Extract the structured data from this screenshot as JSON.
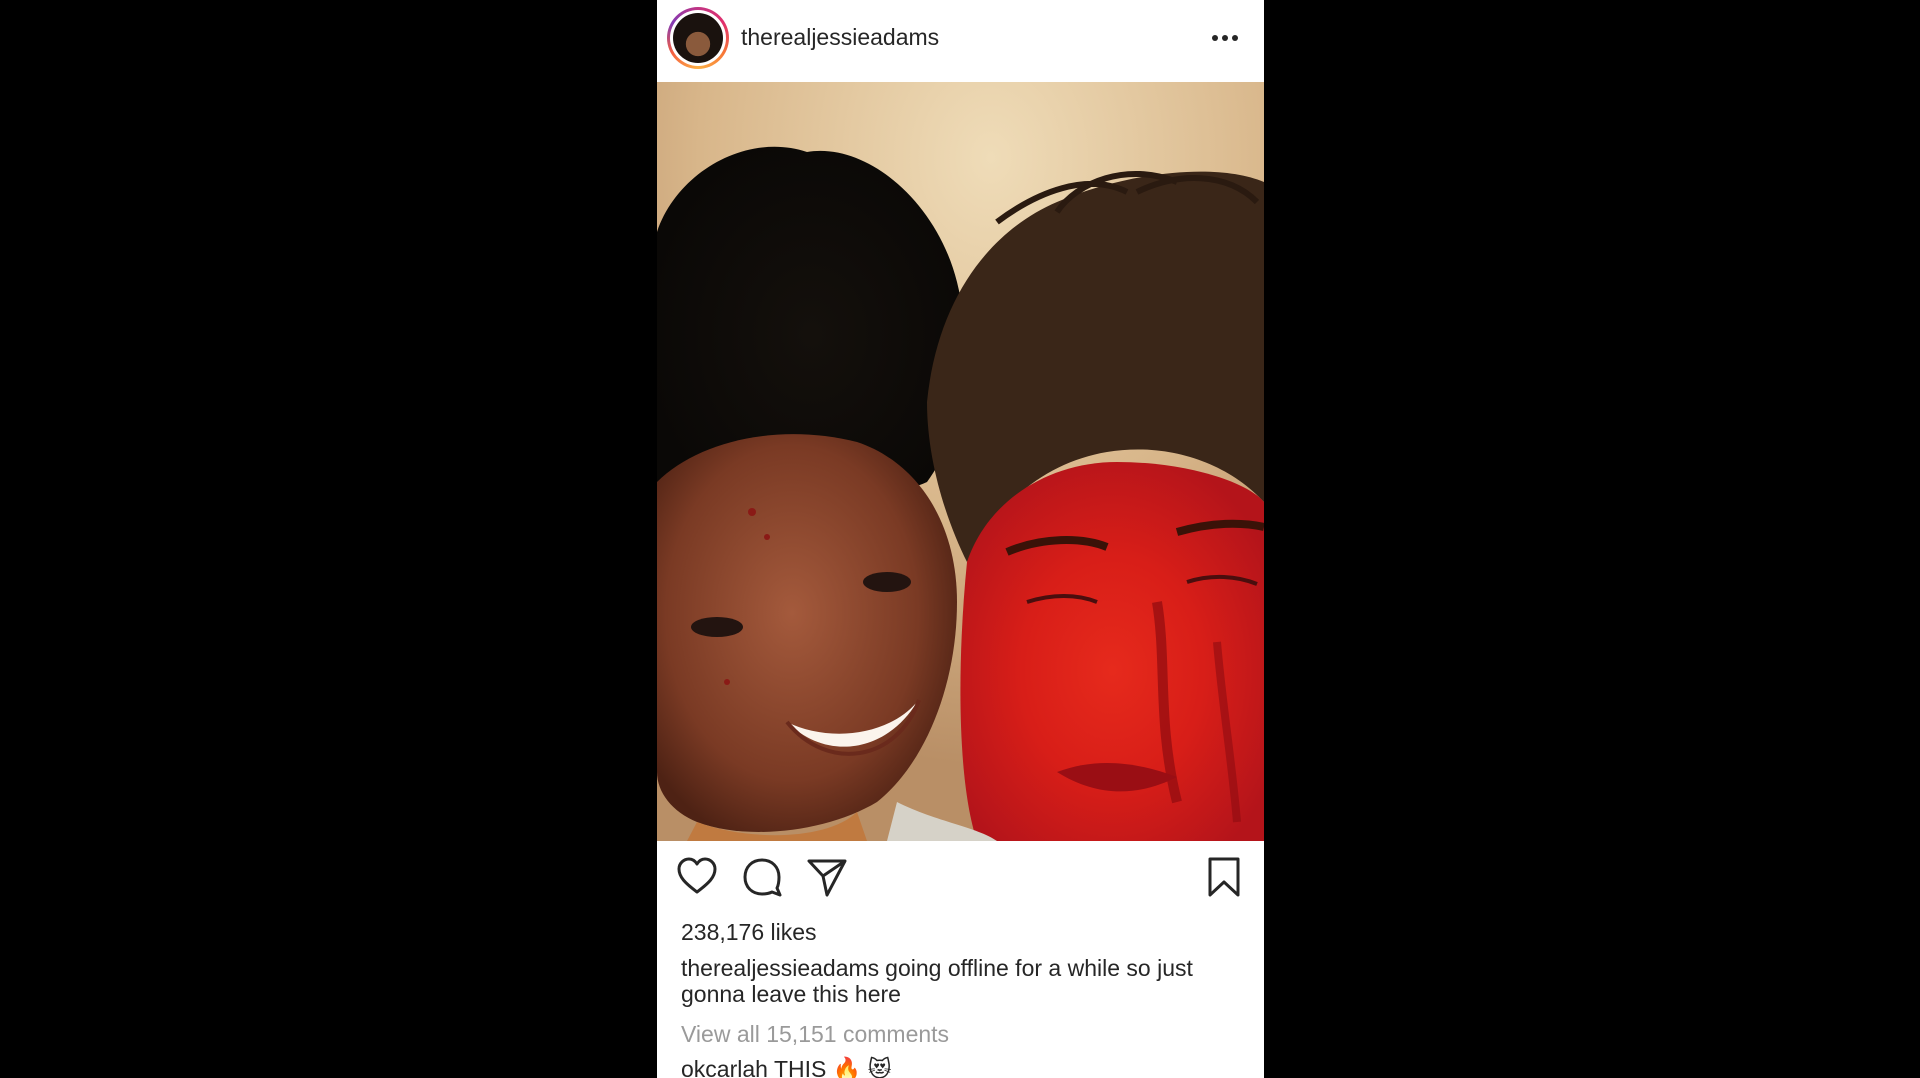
{
  "post": {
    "username": "therealjessieadams",
    "likes": "238,176 likes",
    "caption_user": "therealjessieadams",
    "caption_text": "going offline for a while so just gonna leave this here",
    "view_comments": "View all 15,151 comments",
    "comment_user": "okcarlah",
    "comment_text": "THIS 🔥 😻"
  },
  "icons": {
    "more": "more-options-icon",
    "like": "heart-icon",
    "comment": "comment-icon",
    "share": "send-icon",
    "save": "bookmark-icon"
  },
  "colors": {
    "background": "#000000",
    "card": "#ffffff",
    "text": "#262626",
    "muted": "#9a9a9a",
    "avatar_ring": "#c13584"
  }
}
